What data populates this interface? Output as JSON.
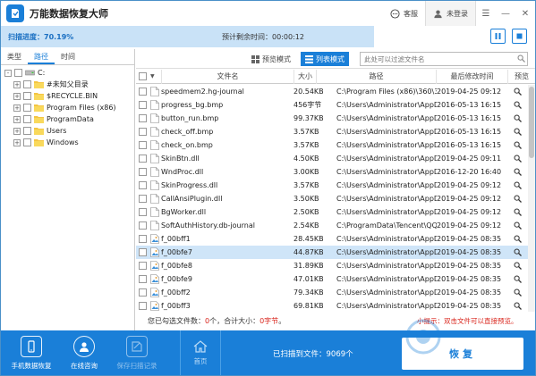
{
  "app": {
    "title": "万能数据恢复大师",
    "service_label": "客服",
    "login_label": "未登录"
  },
  "scan": {
    "progress_label": "扫描进度：70.19%",
    "remain_label": "预计剩余时间：00:00:12"
  },
  "left_tabs": [
    "类型",
    "路径",
    "时间"
  ],
  "tree": [
    {
      "label": "C:",
      "depth": 0,
      "expander": "-"
    },
    {
      "label": "#未知父目录",
      "depth": 1,
      "expander": "+"
    },
    {
      "label": "$RECYCLE.BIN",
      "depth": 1,
      "expander": "+"
    },
    {
      "label": "Program Files (x86)",
      "depth": 1,
      "expander": "+"
    },
    {
      "label": "ProgramData",
      "depth": 1,
      "expander": "+"
    },
    {
      "label": "Users",
      "depth": 1,
      "expander": "+"
    },
    {
      "label": "Windows",
      "depth": 1,
      "expander": "+"
    }
  ],
  "toolbar": {
    "preview_mode": "预览模式",
    "list_mode": "列表模式",
    "filter_placeholder": "此处可以过滤文件名"
  },
  "table": {
    "headers": [
      "文件名",
      "大小",
      "路径",
      "最后修改时间",
      "预览"
    ],
    "rows": [
      {
        "name": "speedmem2.hg-journal",
        "size": "20.54KB",
        "path": "C:\\Program Files (x86)\\360\\36...",
        "time": "2019-04-25  09:12",
        "icon": "file-icon"
      },
      {
        "name": "progress_bg.bmp",
        "size": "456字节",
        "path": "C:\\Users\\Administrator\\AppD...",
        "time": "2016-05-13  16:15",
        "icon": "file-icon"
      },
      {
        "name": "button_run.bmp",
        "size": "99.37KB",
        "path": "C:\\Users\\Administrator\\AppD...",
        "time": "2016-05-13  16:15",
        "icon": "file-icon"
      },
      {
        "name": "check_off.bmp",
        "size": "3.57KB",
        "path": "C:\\Users\\Administrator\\AppD...",
        "time": "2016-05-13  16:15",
        "icon": "file-icon"
      },
      {
        "name": "check_on.bmp",
        "size": "3.57KB",
        "path": "C:\\Users\\Administrator\\AppD...",
        "time": "2016-05-13  16:15",
        "icon": "file-icon"
      },
      {
        "name": "SkinBtn.dll",
        "size": "4.50KB",
        "path": "C:\\Users\\Administrator\\AppD...",
        "time": "2019-04-25  09:11",
        "icon": "file-icon"
      },
      {
        "name": "WndProc.dll",
        "size": "3.00KB",
        "path": "C:\\Users\\Administrator\\AppD...",
        "time": "2016-12-20  16:40",
        "icon": "file-icon"
      },
      {
        "name": "SkinProgress.dll",
        "size": "3.57KB",
        "path": "C:\\Users\\Administrator\\AppD...",
        "time": "2019-04-25  09:12",
        "icon": "file-icon"
      },
      {
        "name": "CallAnsiPlugin.dll",
        "size": "3.50KB",
        "path": "C:\\Users\\Administrator\\AppD...",
        "time": "2019-04-25  09:12",
        "icon": "file-icon"
      },
      {
        "name": "BgWorker.dll",
        "size": "2.50KB",
        "path": "C:\\Users\\Administrator\\AppD...",
        "time": "2019-04-25  09:12",
        "icon": "file-icon"
      },
      {
        "name": "SoftAuthHistory.db-journal",
        "size": "2.54KB",
        "path": "C:\\ProgramData\\Tencent\\QQ...",
        "time": "2019-04-25  09:12",
        "icon": "file-icon"
      },
      {
        "name": "f_00bff1",
        "size": "28.45KB",
        "path": "C:\\Users\\Administrator\\AppD...",
        "time": "2019-04-25  08:35",
        "icon": "image-file-icon"
      },
      {
        "name": "f_00bfe7",
        "size": "44.87KB",
        "path": "C:\\Users\\Administrator\\AppD...",
        "time": "2019-04-25  08:35",
        "icon": "image-file-icon",
        "selected": true
      },
      {
        "name": "f_00bfe8",
        "size": "31.89KB",
        "path": "C:\\Users\\Administrator\\AppD...",
        "time": "2019-04-25  08:35",
        "icon": "image-file-icon"
      },
      {
        "name": "f_00bfe9",
        "size": "47.01KB",
        "path": "C:\\Users\\Administrator\\AppD...",
        "time": "2019-04-25  08:35",
        "icon": "image-file-icon"
      },
      {
        "name": "f_00bff2",
        "size": "79.34KB",
        "path": "C:\\Users\\Administrator\\AppD...",
        "time": "2019-04-25  08:35",
        "icon": "image-file-icon"
      },
      {
        "name": "f_00bff3",
        "size": "69.81KB",
        "path": "C:\\Users\\Administrator\\AppD...",
        "time": "2019-04-25  08:35",
        "icon": "image-file-icon"
      }
    ]
  },
  "status": {
    "prefix": "您已勾选文件数：",
    "count": "0",
    "mid": "个，合计大小：",
    "size": "0字节",
    "suffix": "。",
    "tip": "小提示：双击文件可以直接预览。"
  },
  "bottom": {
    "phone_recover": "手机数据恢复",
    "online_consult": "在线咨询",
    "save_scan": "保存扫描记录",
    "home": "首页",
    "scanned_files": "已扫描到文件：9069个",
    "recover": "恢复"
  },
  "colors": {
    "accent": "#1a7fd8",
    "scan_bar": "#c9e2f7",
    "selected_row": "#cfe5f8",
    "warning": "#d9251c"
  }
}
